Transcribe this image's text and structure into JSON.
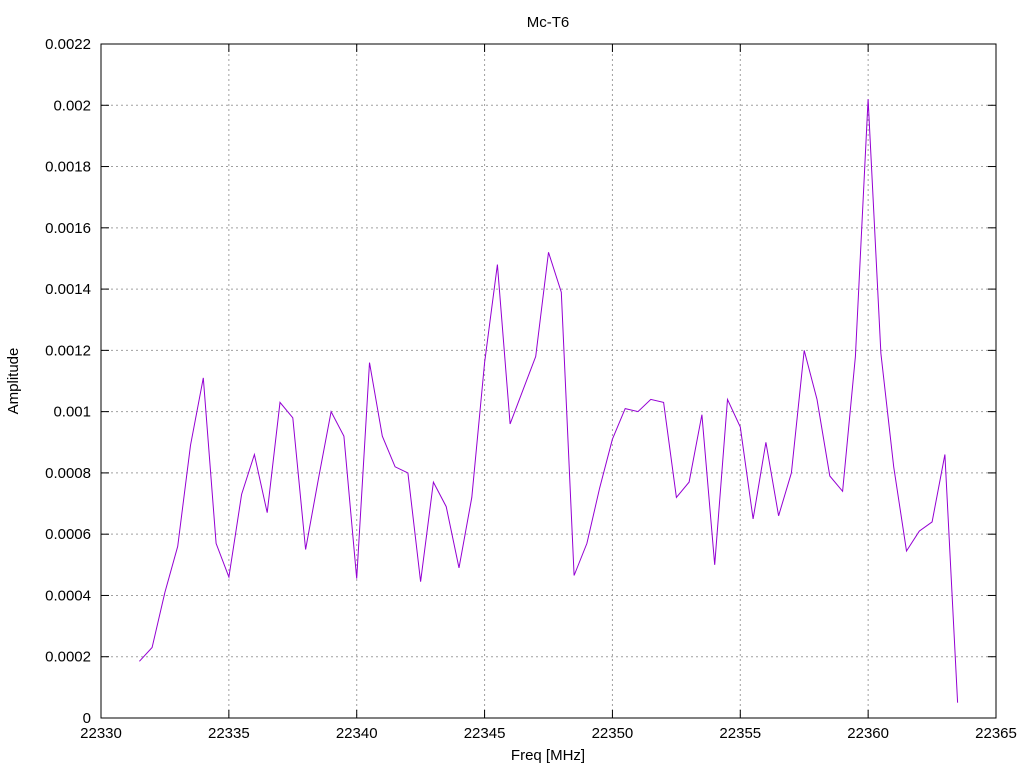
{
  "chart_data": {
    "type": "line",
    "title": "Mc-T6",
    "xlabel": "Freq [MHz]",
    "ylabel": "Amplitude",
    "xlim": [
      22330,
      22365
    ],
    "ylim": [
      0,
      0.0022
    ],
    "xticks": [
      22330,
      22335,
      22340,
      22345,
      22350,
      22355,
      22360,
      22365
    ],
    "yticks": [
      0,
      0.0002,
      0.0004,
      0.0006,
      0.0008,
      0.001,
      0.0012,
      0.0014,
      0.0016,
      0.0018,
      0.002,
      0.0022
    ],
    "ytick_labels": [
      "0",
      "0.0002",
      "0.0004",
      "0.0006",
      "0.0008",
      "0.001",
      "0.0012",
      "0.0014",
      "0.0016",
      "0.0018",
      "0.002",
      "0.0022"
    ],
    "grid": true,
    "series_color": "#9400d3",
    "series": [
      {
        "x": [
          22331.5,
          22332.0,
          22332.5,
          22333.0,
          22333.5,
          22334.0,
          22334.5,
          22335.0,
          22335.5,
          22336.0,
          22336.5,
          22337.0,
          22337.5,
          22338.0,
          22338.5,
          22339.0,
          22339.5,
          22340.0,
          22340.5,
          22341.0,
          22341.5,
          22342.0,
          22342.5,
          22343.0,
          22343.5,
          22344.0,
          22344.5,
          22345.0,
          22345.5,
          22346.0,
          22346.5,
          22347.0,
          22347.5,
          22348.0,
          22348.5,
          22349.0,
          22349.5,
          22350.0,
          22350.5,
          22351.0,
          22351.5,
          22352.0,
          22352.5,
          22353.0,
          22353.5,
          22354.0,
          22354.5,
          22355.0,
          22355.5,
          22356.0,
          22356.5,
          22357.0,
          22357.5,
          22358.0,
          22358.5,
          22359.0,
          22359.5,
          22360.0,
          22360.5,
          22361.0,
          22361.5,
          22362.0,
          22362.5,
          22363.0,
          22363.5
        ],
        "y": [
          0.000185,
          0.00023,
          0.00041,
          0.00056,
          0.00089,
          0.00111,
          0.00057,
          0.00046,
          0.00073,
          0.00086,
          0.00067,
          0.00103,
          0.00098,
          0.00055,
          0.00078,
          0.001,
          0.00092,
          0.000455,
          0.00116,
          0.00092,
          0.00082,
          0.0008,
          0.000445,
          0.00077,
          0.00069,
          0.00049,
          0.00072,
          0.00116,
          0.00148,
          0.00096,
          0.00107,
          0.00118,
          0.00152,
          0.00139,
          0.000465,
          0.00057,
          0.00075,
          0.00091,
          0.00101,
          0.001,
          0.00104,
          0.00103,
          0.00072,
          0.00077,
          0.00099,
          0.0005,
          0.00104,
          0.00095,
          0.00065,
          0.0009,
          0.00066,
          0.0008,
          0.0012,
          0.00104,
          0.00079,
          0.00074,
          0.00118,
          0.00202,
          0.00119,
          0.00082,
          0.000545,
          0.00061,
          0.00064,
          0.00086,
          5e-05
        ]
      }
    ]
  }
}
